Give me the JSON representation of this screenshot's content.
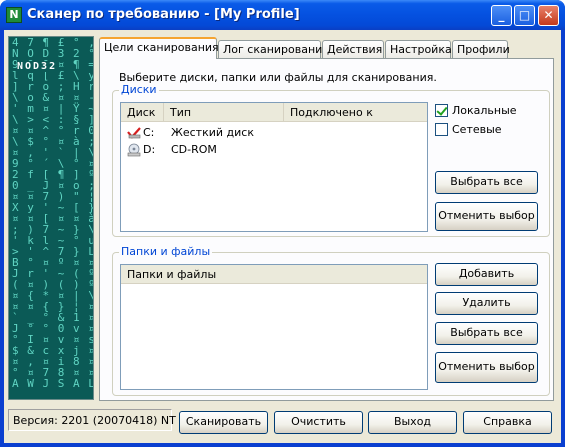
{
  "window": {
    "title": "Сканер по требованию - [My Profile]",
    "icon_glyph": "N",
    "min_glyph": "_",
    "max_glyph": "□",
    "close_glyph": "✕"
  },
  "sidebar": {
    "brand": "NOD32",
    "matrix_text": "4 7 ¶ £ ° , \\ ´\nN O D 3 2 ° \\\n9 0 0 ¤ ¶ = ) }\nl q [ £ \\ y \\\n] r o ; H r u\n\\ o & ¤ ¤ - $\n' m ¤ | Ÿ ~ i u\n\\ > < : § ] \\\n¤ ¤ ^ ° r 0 )\n\\ $ ° ¤ à ; :\n¤ , ' ` | \\ i\n9 ° ´ \\ ° ¤ }\n2 f [ ¶ ] º ¤\n0 _ J ¤ o ; y\n¤ ¤ 7 ) \" ¦ `\nX y ' ~ [ } q\n¤ ¤ [ ¤ ¤ à ¤\n; ) 7 ~ } \\ ,\n' k l ~ ° u H\n> ' ^ 7 } L '\nB ° ¤ º ¤ ¤ S\nJ r ' ~ ( º ~\n( ¤ ) ( ) º >\n¤ { * ¤ | \\ ¤\n¤ ¤ { } ¦ ¤ °\n` _ ° & 1 ¤ ¦\nJ ° ° 0 v ¤ ¤\n° I ¤ v ¤ s s\n$ & c x j ¤ ¤\n¤ , ¤ i 8 ¤ ¤\n° ¤ 7 8 ¤ ¤ ¤\nA W J S A L S"
  },
  "tabs": [
    {
      "label": "Цели сканирования",
      "active": true
    },
    {
      "label": "Лог сканирования",
      "active": false
    },
    {
      "label": "Действия",
      "active": false
    },
    {
      "label": "Настройка",
      "active": false
    },
    {
      "label": "Профили",
      "active": false
    }
  ],
  "targets": {
    "hint": "Выберите диски, папки или файлы для сканирования.",
    "drives_group": {
      "title": "Диски",
      "columns": [
        "Диск",
        "Тип",
        "Подключено к"
      ],
      "rows": [
        {
          "drive": "C:",
          "type": "Жесткий диск",
          "connected": "",
          "icon": "hard-disk-icon",
          "checked": true
        },
        {
          "drive": "D:",
          "type": "CD-ROM",
          "connected": "",
          "icon": "cd-rom-icon",
          "checked": false
        }
      ],
      "local_label": "Локальные",
      "local_checked": true,
      "network_label": "Сетевые",
      "network_checked": false,
      "select_all": "Выбрать все",
      "deselect": "Отменить выбор"
    },
    "files_group": {
      "title": "Папки и файлы",
      "column": "Папки и файлы",
      "add": "Добавить",
      "remove": "Удалить",
      "select_all": "Выбрать все",
      "deselect": "Отменить выбор"
    }
  },
  "footer": {
    "version": "Версия: 2201 (20070418) NT",
    "scan": "Сканировать",
    "clear": "Очистить",
    "exit": "Выход",
    "help": "Справка"
  },
  "colors": {
    "title_bar": "#0551e0",
    "group_title": "#0046d5",
    "tab_accent": "#f5a431",
    "sidebar_bg": "#0b5a56",
    "check_mark": "#21a121"
  }
}
